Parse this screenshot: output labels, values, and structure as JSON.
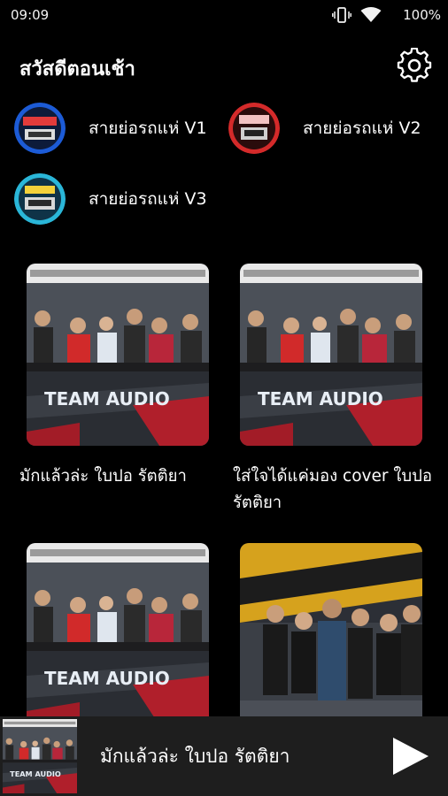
{
  "status": {
    "time": "09:09",
    "battery": "100%"
  },
  "header": {
    "greeting": "สวัสดีตอนเช้า"
  },
  "playlists": [
    {
      "label": "สายย่อรถแห่ V1"
    },
    {
      "label": "สายย่อรถแห่ V2"
    },
    {
      "label": "สายย่อรถแห่ V3"
    }
  ],
  "videos": [
    {
      "title": "มักแล้วล่ะ ใบปอ รัตติยา"
    },
    {
      "title": "ใส่ใจได้แค่มอง cover ใบปอ รัตติยา"
    },
    {
      "title": ""
    },
    {
      "title": ""
    }
  ],
  "player": {
    "title": "มักแล้วล่ะ ใบปอ รัตติยา"
  },
  "colors": {
    "background": "#000000",
    "player_bar": "#1e1e1e",
    "accent_red": "#d42a2a"
  }
}
